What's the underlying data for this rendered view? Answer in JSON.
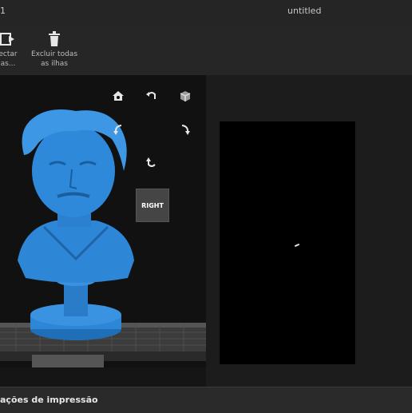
{
  "titlebar": {
    "crumb": "1",
    "document_title": "untitled"
  },
  "toolbar": {
    "tools": [
      {
        "label": "ectar\nas...",
        "icon": "detect-icon"
      },
      {
        "label": "Excluir todas\nas ilhas",
        "icon": "trash-icon"
      }
    ]
  },
  "navigation": {
    "view_label": "RIGHT",
    "buttons": [
      "home-icon",
      "rotate-ccw-icon",
      "cube-view-icon",
      "rotate-left-icon",
      "rotate-right-icon",
      "rotate-down-icon"
    ]
  },
  "colors": {
    "model": "#2e86d6",
    "bed": "#4a4a4a",
    "accent": "#ffffff"
  },
  "bottom": {
    "section_label": "ações de impressão"
  }
}
